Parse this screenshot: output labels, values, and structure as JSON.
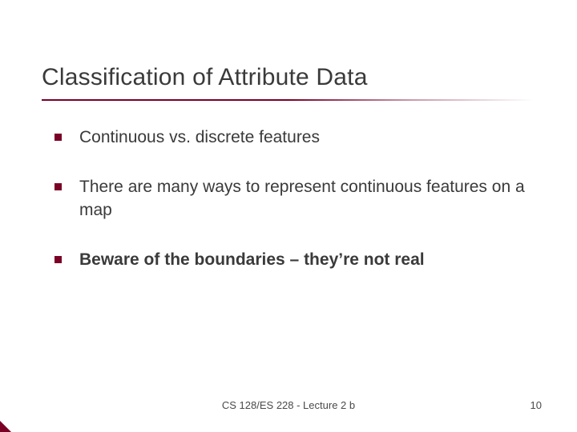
{
  "slide": {
    "title": "Classification of Attribute Data",
    "bullets": [
      {
        "text": "Continuous vs. discrete features",
        "bold": false
      },
      {
        "text": "There are many ways to represent continuous features on a map",
        "bold": false
      },
      {
        "text": "Beware of the boundaries – they’re not real",
        "bold": true
      }
    ],
    "footer": {
      "center": "CS 128/ES 228 - Lecture 2 b",
      "page_number": "10"
    }
  }
}
